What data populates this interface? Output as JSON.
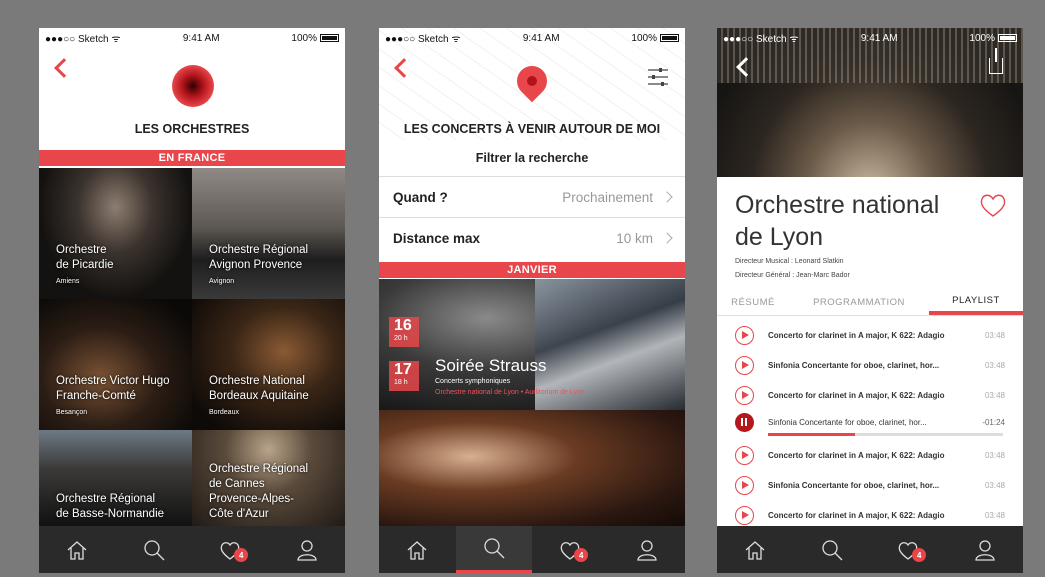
{
  "status": {
    "signal": "●●●○○ Sketch ᯤ",
    "time": "9:41 AM",
    "battery": "100%"
  },
  "colors": {
    "accent": "#e8464a",
    "tabbar": "#2a2a2a"
  },
  "tabbar": {
    "badge": "4",
    "icons": [
      "home-icon",
      "search-icon",
      "favorites-icon",
      "profile-icon"
    ]
  },
  "screen1": {
    "title": "LES ORCHESTRES",
    "section": "EN FRANCE",
    "orchestras": [
      {
        "name_1": "Orchestre",
        "name_2": "de Picardie",
        "name_3": "",
        "city": "Amiens"
      },
      {
        "name_1": "Orchestre Régional",
        "name_2": "Avignon Provence",
        "name_3": "",
        "city": "Avignon"
      },
      {
        "name_1": "Orchestre Victor Hugo",
        "name_2": "Franche-Comté",
        "name_3": "",
        "city": "Besançon"
      },
      {
        "name_1": "Orchestre National",
        "name_2": "Bordeaux Aquitaine",
        "name_3": "",
        "city": "Bordeaux"
      },
      {
        "name_1": "Orchestre Régional",
        "name_2": "de Basse-Normandie",
        "name_3": "",
        "city": ""
      },
      {
        "name_1": "Orchestre Régional",
        "name_2": "de Cannes",
        "name_3": "Provence-Alpes-Côte d'Azur",
        "city": ""
      }
    ]
  },
  "screen2": {
    "title": "LES CONCERTS À VENIR AUTOUR DE MOI",
    "filter_label": "Filtrer la recherche",
    "when_label": "Quand ?",
    "when_value": "Prochainement",
    "distance_label": "Distance max",
    "distance_value": "10 km",
    "month": "JANVIER",
    "dates": [
      {
        "day": "16",
        "hour": "20 h"
      },
      {
        "day": "17",
        "hour": "18 h"
      }
    ],
    "concert_title": "Soirée Strauss",
    "concert_type": "Concerts symphoniques",
    "concert_location": "Orchestre national de Lyon • Auditorium de Lyon"
  },
  "screen3": {
    "title": "Orchestre national de Lyon",
    "music_director": "Directeur Musical : Leonard Slatkin",
    "general_director": "Directeur Général : Jean-Marc Bador",
    "tabs": [
      "RÉSUMÉ",
      "PROGRAMMATION",
      "PLAYLIST"
    ],
    "progress_fraction": 0.37,
    "tracks": [
      {
        "title": "Concerto for clarinet in A major, K 622: Adagio",
        "duration": "03:48"
      },
      {
        "title": "Sinfonia Concertante for oboe, clarinet, hor...",
        "duration": "03:48"
      },
      {
        "title": "Concerto for clarinet in A major, K 622: Adagio",
        "duration": "03:48"
      },
      {
        "title": "Sinfonia Concertante for oboe, clarinet, hor...",
        "duration": "-01:24"
      },
      {
        "title": "Concerto for clarinet in A major, K 622: Adagio",
        "duration": "03:48"
      },
      {
        "title": "Sinfonia Concertante for oboe, clarinet, hor...",
        "duration": "03:48"
      },
      {
        "title": "Concerto for clarinet in A major, K 622: Adagio",
        "duration": "03:48"
      }
    ]
  }
}
